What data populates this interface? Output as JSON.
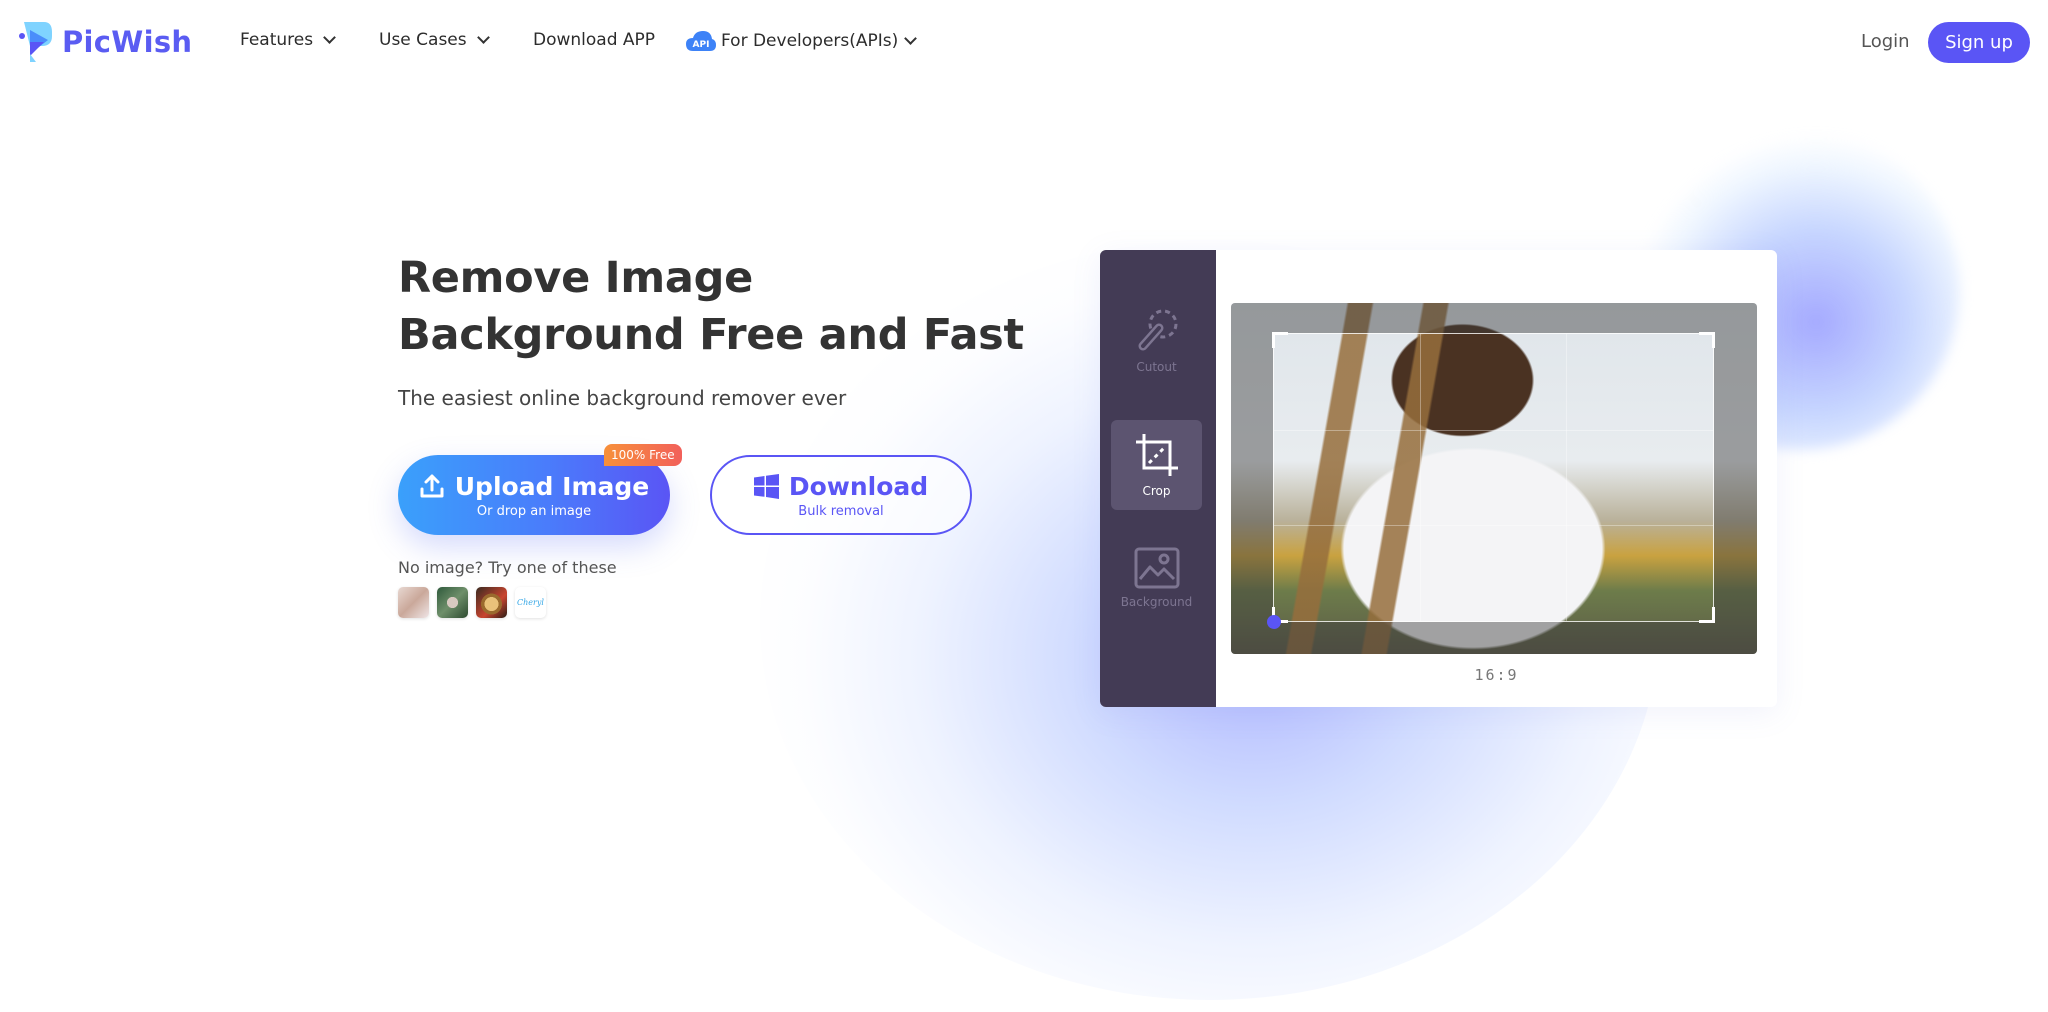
{
  "brand": {
    "name": "PicWish",
    "accent": "#5a55f5"
  },
  "nav": {
    "items": [
      {
        "label": "Features",
        "has_dropdown": true
      },
      {
        "label": "Use Cases",
        "has_dropdown": true
      },
      {
        "label": "Download APP",
        "has_dropdown": false
      },
      {
        "label": "For Developers(APIs)",
        "has_dropdown": true,
        "badge": "API"
      }
    ],
    "login_label": "Login",
    "signup_label": "Sign up"
  },
  "hero": {
    "title_line1": "Remove Image",
    "title_line2": "Background Free and Fast",
    "subtitle": "The easiest online background remover ever",
    "upload": {
      "label": "Upload Image",
      "sublabel": "Or drop an image",
      "badge": "100% Free"
    },
    "download": {
      "label": "Download",
      "sublabel": "Bulk removal",
      "icon": "windows-icon"
    },
    "samples_label": "No image? Try one of these",
    "samples": [
      {
        "name": "sample-woman",
        "alt": ""
      },
      {
        "name": "sample-watch",
        "alt": ""
      },
      {
        "name": "sample-dog",
        "alt": ""
      },
      {
        "name": "sample-logo",
        "alt": "Cheryl"
      }
    ]
  },
  "editor": {
    "tools": [
      {
        "label": "Cutout",
        "icon": "cutout-icon",
        "active": false
      },
      {
        "label": "Crop",
        "icon": "crop-icon",
        "active": true
      },
      {
        "label": "Background",
        "icon": "image-icon",
        "active": false
      }
    ],
    "aspect_ratio": "16:9"
  }
}
